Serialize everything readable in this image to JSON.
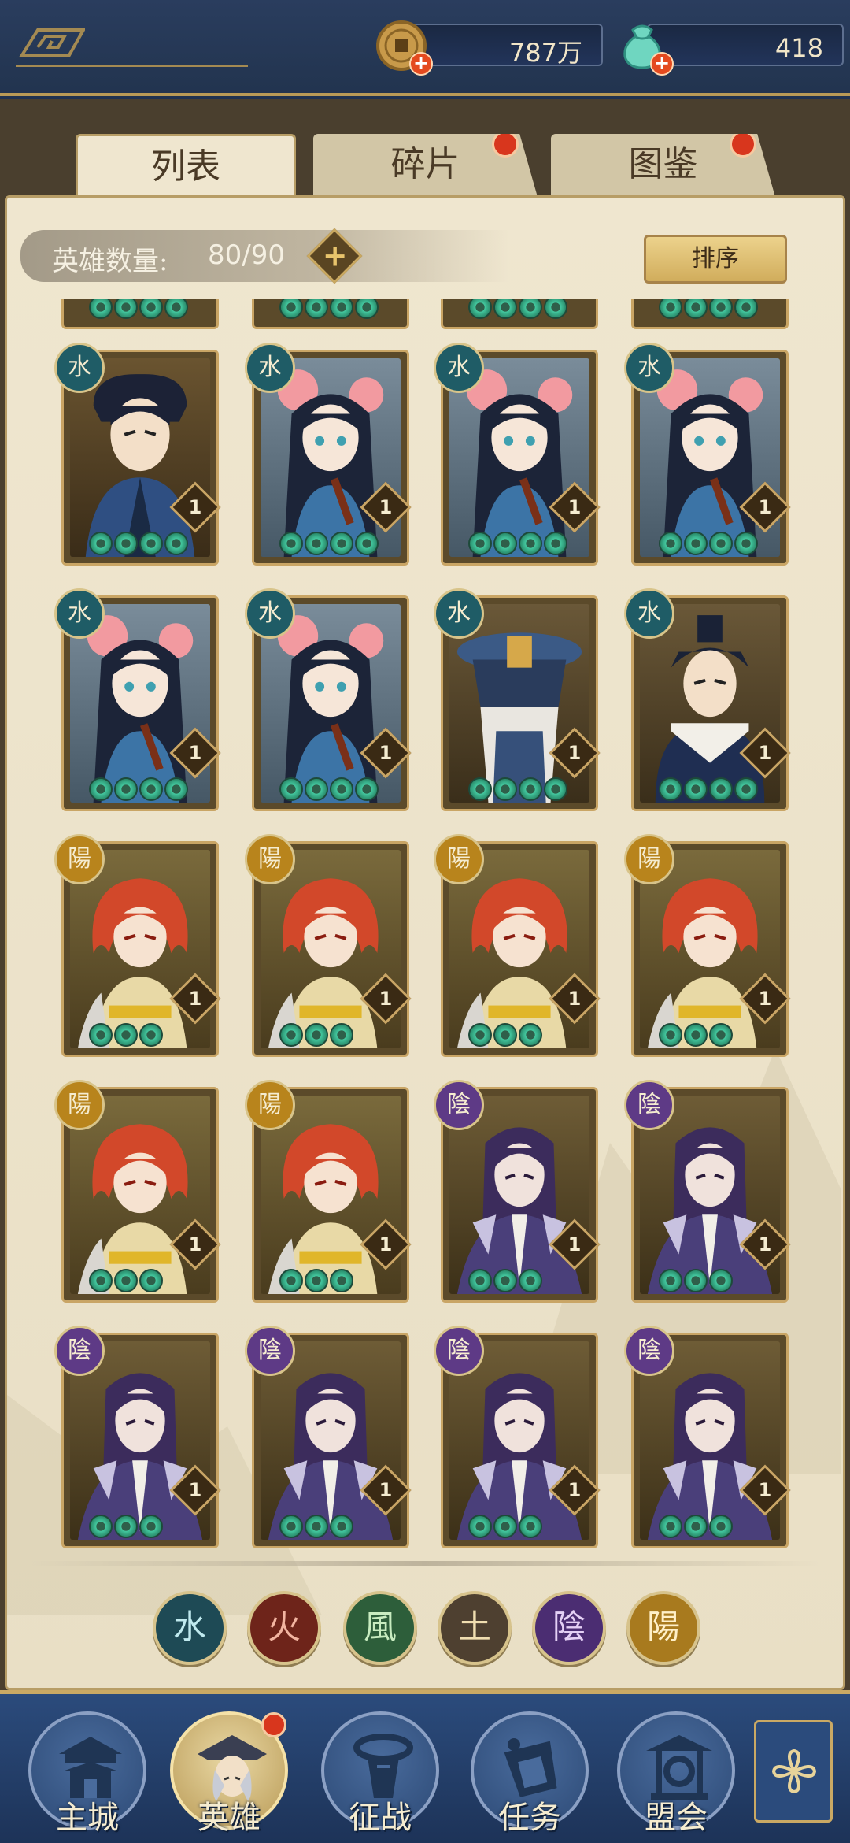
{
  "currencies": {
    "coins": {
      "value": "787万",
      "icon": "coin-icon"
    },
    "jade": {
      "value": "418",
      "icon": "jade-pouch-icon"
    }
  },
  "tabs": [
    {
      "label": "列表",
      "active": true,
      "badge": false
    },
    {
      "label": "碎片",
      "active": false,
      "badge": true
    },
    {
      "label": "图鉴",
      "active": false,
      "badge": true
    }
  ],
  "hero_count": {
    "label": "英雄数量:",
    "value": "80/90"
  },
  "sort_label": "排序",
  "elements": {
    "water": {
      "glyph": "水",
      "color": "#1f5c66"
    },
    "fire": {
      "glyph": "火",
      "color": "#7a2a1c"
    },
    "wind": {
      "glyph": "風",
      "color": "#2f6a3e"
    },
    "earth": {
      "glyph": "土",
      "color": "#5b4a2e"
    },
    "yin": {
      "glyph": "陰",
      "color": "#5e3a86"
    },
    "yang": {
      "glyph": "陽",
      "color": "#b8841c"
    }
  },
  "heroes": [
    {
      "element": "water",
      "glyph": "水",
      "portrait": "swordsman",
      "level": "1",
      "stars": 4
    },
    {
      "element": "water",
      "glyph": "水",
      "portrait": "flower-maiden",
      "level": "1",
      "stars": 4
    },
    {
      "element": "water",
      "glyph": "水",
      "portrait": "flower-maiden",
      "level": "1",
      "stars": 4
    },
    {
      "element": "water",
      "glyph": "水",
      "portrait": "flower-maiden",
      "level": "1",
      "stars": 4
    },
    {
      "element": "water",
      "glyph": "水",
      "portrait": "flower-maiden",
      "level": "1",
      "stars": 4
    },
    {
      "element": "water",
      "glyph": "水",
      "portrait": "flower-maiden",
      "level": "1",
      "stars": 4
    },
    {
      "element": "water",
      "glyph": "水",
      "portrait": "masked-warrior",
      "level": "1",
      "stars": 4
    },
    {
      "element": "water",
      "glyph": "水",
      "portrait": "scholar",
      "level": "1",
      "stars": 4
    },
    {
      "element": "yang",
      "glyph": "陽",
      "portrait": "red-hair-girl",
      "level": "1",
      "stars": 3
    },
    {
      "element": "yang",
      "glyph": "陽",
      "portrait": "red-hair-girl",
      "level": "1",
      "stars": 3
    },
    {
      "element": "yang",
      "glyph": "陽",
      "portrait": "red-hair-girl",
      "level": "1",
      "stars": 3
    },
    {
      "element": "yang",
      "glyph": "陽",
      "portrait": "red-hair-girl",
      "level": "1",
      "stars": 3
    },
    {
      "element": "yang",
      "glyph": "陽",
      "portrait": "red-hair-girl",
      "level": "1",
      "stars": 3
    },
    {
      "element": "yang",
      "glyph": "陽",
      "portrait": "red-hair-girl",
      "level": "1",
      "stars": 3
    },
    {
      "element": "yin",
      "glyph": "陰",
      "portrait": "purple-hair-man",
      "level": "1",
      "stars": 3
    },
    {
      "element": "yin",
      "glyph": "陰",
      "portrait": "purple-hair-man",
      "level": "1",
      "stars": 3
    },
    {
      "element": "yin",
      "glyph": "陰",
      "portrait": "purple-hair-man",
      "level": "1",
      "stars": 3
    },
    {
      "element": "yin",
      "glyph": "陰",
      "portrait": "purple-hair-man",
      "level": "1",
      "stars": 3
    },
    {
      "element": "yin",
      "glyph": "陰",
      "portrait": "purple-hair-man",
      "level": "1",
      "stars": 3
    },
    {
      "element": "yin",
      "glyph": "陰",
      "portrait": "purple-hair-man",
      "level": "1",
      "stars": 3
    }
  ],
  "filters": [
    {
      "key": "water",
      "glyph": "水",
      "bg": "#1e4a55",
      "fg": "#bfe9ee"
    },
    {
      "key": "fire",
      "glyph": "火",
      "bg": "#6e241a",
      "fg": "#f2b4a0"
    },
    {
      "key": "wind",
      "glyph": "風",
      "bg": "#2d5e3a",
      "fg": "#c8ecc0"
    },
    {
      "key": "earth",
      "glyph": "土",
      "bg": "#4e4030",
      "fg": "#f0deb0"
    },
    {
      "key": "yin",
      "glyph": "陰",
      "bg": "#4b2d72",
      "fg": "#e4d0f5"
    },
    {
      "key": "yang",
      "glyph": "陽",
      "bg": "#a87a1e",
      "fg": "#fff0c8"
    }
  ],
  "nav": [
    {
      "label": "主城",
      "icon": "city-gate-icon",
      "active": false
    },
    {
      "label": "英雄",
      "icon": "hero-portrait-icon",
      "active": true
    },
    {
      "label": "征战",
      "icon": "battle-icon",
      "active": false
    },
    {
      "label": "任务",
      "icon": "scroll-task-icon",
      "active": false
    },
    {
      "label": "盟会",
      "icon": "guild-pavilion-icon",
      "active": false
    }
  ],
  "nav_more_icon": "flower-menu-icon"
}
